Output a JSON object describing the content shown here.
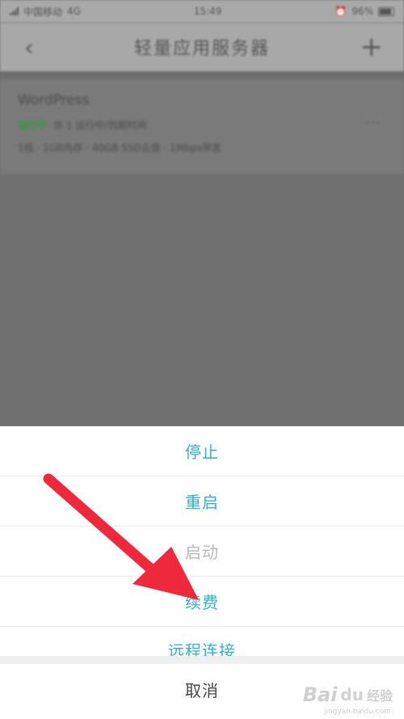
{
  "status_bar": {
    "carrier": "中国移动",
    "network": "4G",
    "time": "15:49",
    "battery": "96%"
  },
  "nav": {
    "back_icon": "chevron-left-icon",
    "title": "轻量应用服务器",
    "add_icon": "plus-icon"
  },
  "server_card": {
    "name": "WordPress",
    "status": "运行中",
    "info": "华 1 运行中/到期时间",
    "more": "···",
    "meta": "1核 · 1GB内存 · 40GB SSD云盘 · 1Mbps带宽"
  },
  "action_sheet": {
    "items": [
      {
        "label": "停止",
        "enabled": true
      },
      {
        "label": "重启",
        "enabled": true
      },
      {
        "label": "启动",
        "enabled": false
      },
      {
        "label": "续费",
        "enabled": true
      },
      {
        "label": "远程连接",
        "enabled": true
      }
    ],
    "cancel": "取消"
  },
  "annotation": {
    "arrow_color": "#f0283c"
  },
  "colors": {
    "accent": "#2fb0d2",
    "disabled": "#b8b8b8",
    "status_green": "#2f9a44"
  },
  "watermark": {
    "brand": "Bai",
    "paw": "du",
    "text": "经验",
    "url": "jingyan.baidu.com"
  }
}
